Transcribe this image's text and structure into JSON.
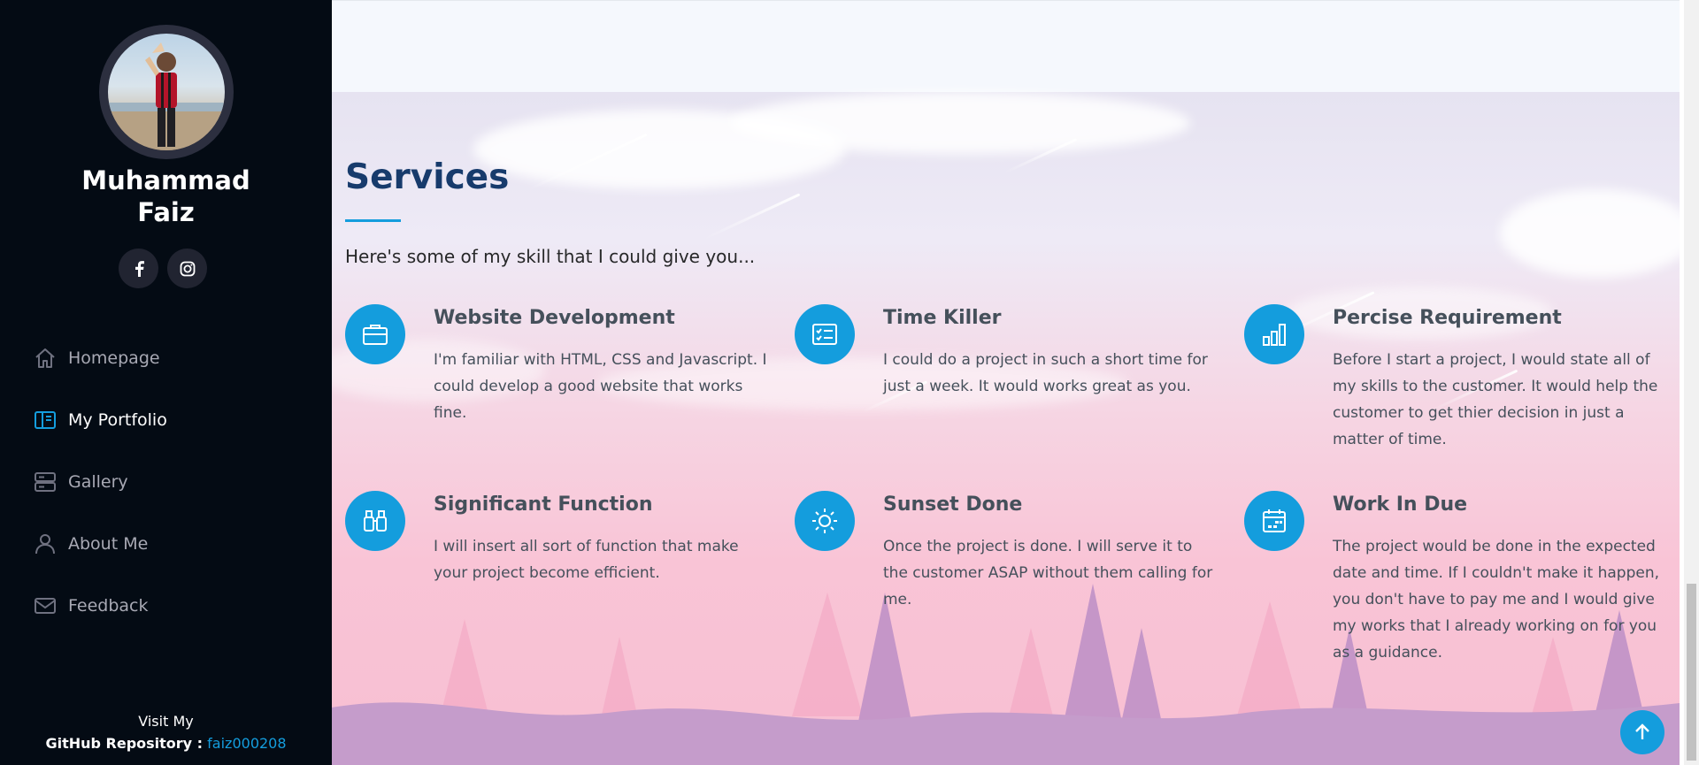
{
  "sidebar": {
    "name_line1": "Muhammad",
    "name_line2": "Faiz",
    "socials": [
      {
        "icon": "facebook-icon"
      },
      {
        "icon": "instagram-icon"
      }
    ],
    "nav": [
      {
        "label": "Homepage",
        "icon": "home-icon",
        "active": false
      },
      {
        "label": "My Portfolio",
        "icon": "book-icon",
        "active": true
      },
      {
        "label": "Gallery",
        "icon": "server-icon",
        "active": false
      },
      {
        "label": "About Me",
        "icon": "person-icon",
        "active": false
      },
      {
        "label": "Feedback",
        "icon": "envelope-icon",
        "active": false
      }
    ],
    "footer": {
      "visit": "Visit My",
      "repo_label": "GitHub Repository :",
      "repo_link": "faiz000208"
    }
  },
  "services": {
    "title": "Services",
    "intro": "Here's some of my skill that I could give you...",
    "items": [
      {
        "icon": "briefcase-icon",
        "title": "Website Development",
        "desc": "I'm familiar with HTML, CSS and Javascript. I could develop a good website that works fine."
      },
      {
        "icon": "card-checklist-icon",
        "title": "Time Killer",
        "desc": "I could do a project in such a short time for just a week. It would works great as you."
      },
      {
        "icon": "bar-chart-icon",
        "title": "Percise Requirement",
        "desc": "Before I start a project, I would state all of my skills to the customer. It would help the customer to get thier decision in just a matter of time."
      },
      {
        "icon": "binoculars-icon",
        "title": "Significant Function",
        "desc": "I will insert all sort of function that make your project become efficient."
      },
      {
        "icon": "sun-icon",
        "title": "Sunset Done",
        "desc": "Once the project is done. I will serve it to the customer ASAP without them calling for me."
      },
      {
        "icon": "calendar-icon",
        "title": "Work In Due",
        "desc": "The project would be done in the expected date and time. If I couldn't make it happen, you don't have to pay me and I would give my works that I already working on for you as a guidance."
      }
    ]
  },
  "colors": {
    "sidebar_bg": "#040b14",
    "accent": "#149ddd",
    "heading": "#173b6c",
    "text": "#45505b"
  }
}
